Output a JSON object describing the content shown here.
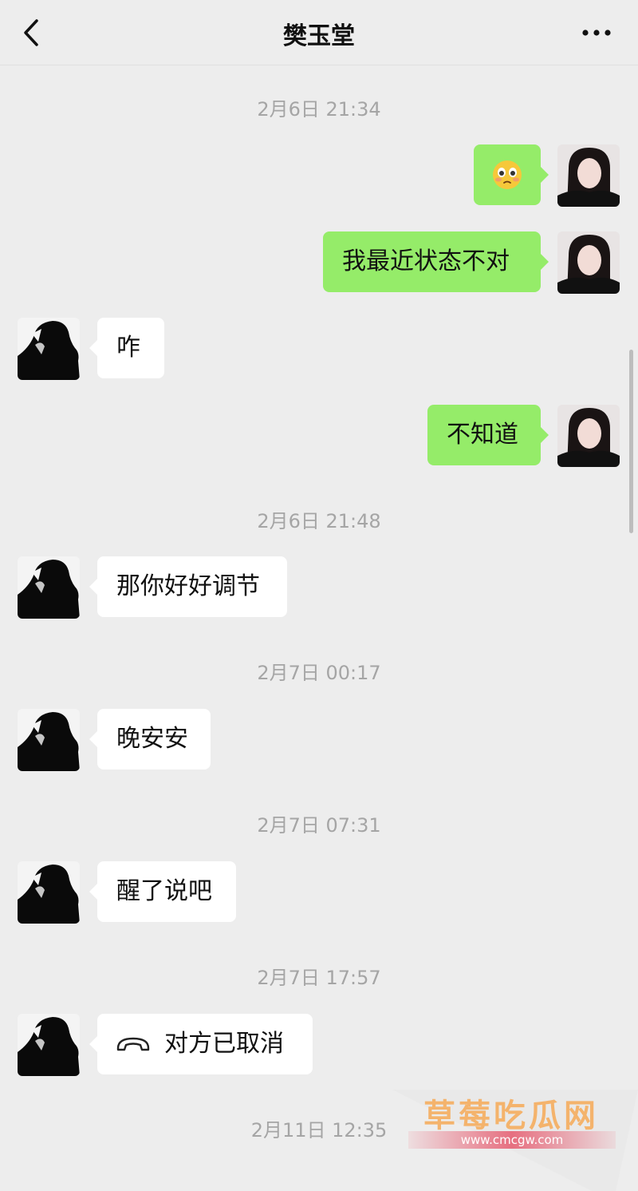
{
  "header": {
    "title": "樊玉堂",
    "back_icon": "chevron-left-icon",
    "more_icon": "more-dots-icon"
  },
  "messages": [
    {
      "type": "timestamp",
      "text": "2月6日 21:34"
    },
    {
      "type": "out",
      "emoji": "worried-face"
    },
    {
      "type": "out",
      "text": "我最近状态不对"
    },
    {
      "type": "in",
      "text": "咋"
    },
    {
      "type": "out",
      "text": "不知道"
    },
    {
      "type": "timestamp",
      "text": "2月6日 21:48"
    },
    {
      "type": "in",
      "text": "那你好好调节"
    },
    {
      "type": "timestamp",
      "text": "2月7日 00:17"
    },
    {
      "type": "in",
      "text": "晚安安"
    },
    {
      "type": "timestamp",
      "text": "2月7日 07:31"
    },
    {
      "type": "in",
      "text": "醒了说吧"
    },
    {
      "type": "timestamp",
      "text": "2月7日 17:57"
    },
    {
      "type": "in",
      "icon": "phone-hangup-icon",
      "text": "对方已取消"
    },
    {
      "type": "timestamp",
      "text": "2月11日 12:35"
    }
  ],
  "watermark": {
    "main": "草莓吃瓜网",
    "sub": "www.cmcgw.com"
  },
  "colors": {
    "background": "#ededed",
    "outgoing_bubble": "#95ec69",
    "incoming_bubble": "#ffffff",
    "timestamp": "#a5a5a5"
  }
}
